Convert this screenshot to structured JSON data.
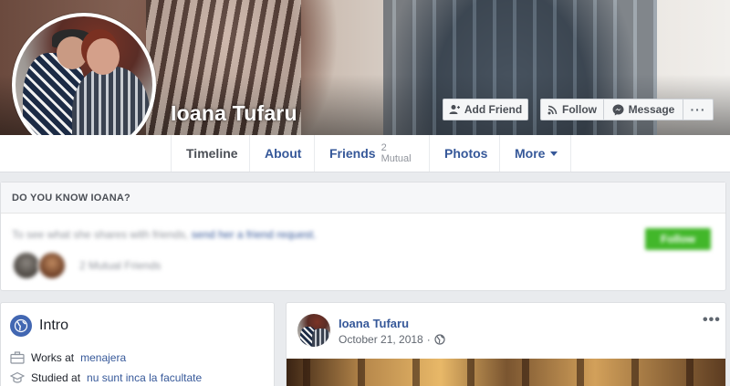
{
  "profile": {
    "name": "Ioana Tufaru"
  },
  "actions": {
    "add_friend": "Add Friend",
    "follow": "Follow",
    "message": "Message",
    "more": "···"
  },
  "nav": {
    "timeline": "Timeline",
    "about": "About",
    "friends": "Friends",
    "friends_mutual": "2 Mutual",
    "photos": "Photos",
    "more": "More"
  },
  "know": {
    "heading": "DO YOU KNOW IOANA?",
    "text": "To see what she shares with friends,",
    "link": "send her a friend request.",
    "mutual": "2 Mutual Friends",
    "follow_button": "Follow"
  },
  "intro": {
    "title": "Intro",
    "work_prefix": "Works at",
    "work_place": "menajera",
    "study_prefix": "Studied at",
    "study_place": "nu sunt inca la facultate"
  },
  "post": {
    "author": "Ioana Tufaru",
    "date": "October 21, 2018",
    "separator": "·",
    "menu": "•••"
  },
  "icons": {
    "privacy": "globe-icon",
    "intro": "globe-icon",
    "work": "briefcase-icon",
    "study": "graduation-cap-icon"
  },
  "colors": {
    "link": "#365899",
    "brand": "#4267b2",
    "follow_green": "#42b72a",
    "page_bg": "#e9ebee"
  }
}
